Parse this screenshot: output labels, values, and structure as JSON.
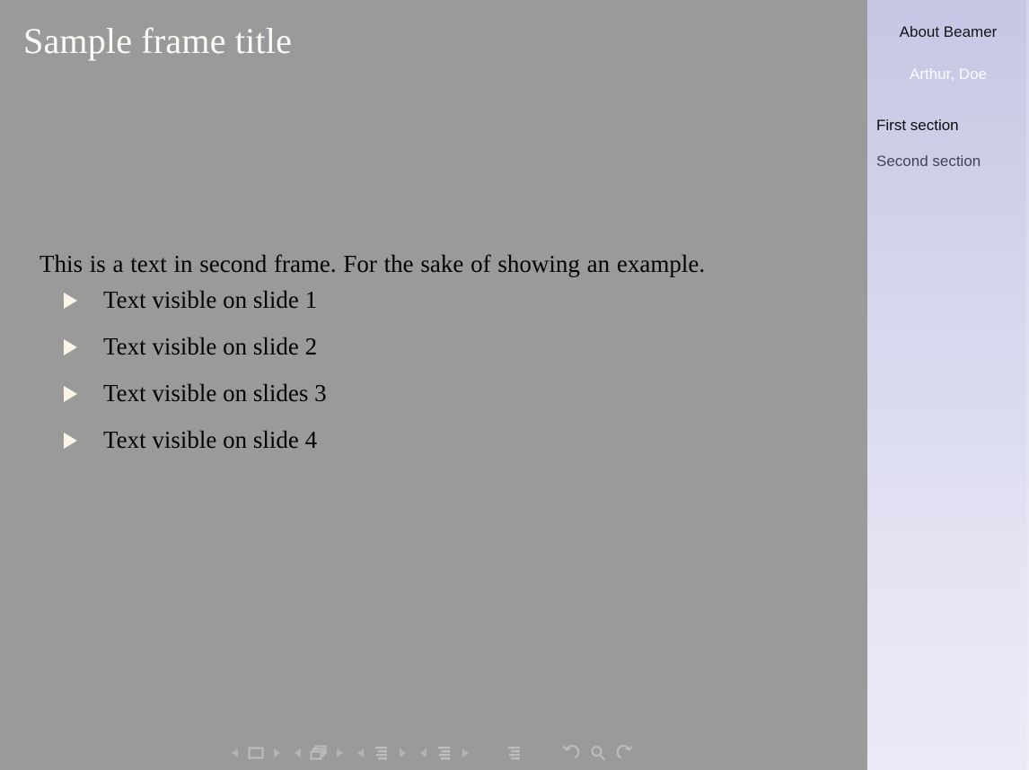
{
  "slide": {
    "frame_title": "Sample frame title",
    "body_paragraph": "This is a text in second frame. For the sake of showing an example.",
    "items": [
      {
        "label": "Text visible on slide 1"
      },
      {
        "label": "Text visible on slide 2"
      },
      {
        "label": "Text visible on slides 3"
      },
      {
        "label": "Text visible on slide 4"
      }
    ]
  },
  "sidebar": {
    "presentation_title": "About Beamer",
    "author": "Arthur, Doe",
    "sections": [
      {
        "label": "First section",
        "state": "active"
      },
      {
        "label": "Second section",
        "state": "inactive"
      }
    ]
  },
  "navbar": {
    "groups": [
      {
        "name": "slide-navigation",
        "prev_icon": "triangle-left-icon",
        "symbol_icon": "single-slide-icon",
        "next_icon": "triangle-right-icon"
      },
      {
        "name": "frame-navigation",
        "prev_icon": "triangle-left-icon",
        "symbol_icon": "stacked-frames-icon",
        "next_icon": "triangle-right-icon"
      },
      {
        "name": "subsection-navigation",
        "prev_icon": "triangle-left-icon",
        "symbol_icon": "subsection-lines-icon",
        "next_icon": "triangle-right-icon"
      },
      {
        "name": "section-navigation",
        "prev_icon": "triangle-left-icon",
        "symbol_icon": "section-lines-icon",
        "next_icon": "triangle-right-icon"
      }
    ],
    "toc_icon": "table-of-contents-icon",
    "back_icon": "back-arrow-icon",
    "search_icon": "search-magnifier-icon",
    "forward_icon": "forward-arrow-icon"
  },
  "colors": {
    "slide_background": "#9a9a9a",
    "sidebar_top": "#c7c7e6",
    "sidebar_bottom": "#eaeaf7",
    "title_text": "#fdfbf5",
    "body_text": "#000000",
    "bullet": "#fdf6e8",
    "sidebar_active": "#0a0a0a",
    "sidebar_inactive": "#41415f",
    "sidebar_author": "#fbfbff",
    "nav_symbol": "#b9b9b9"
  }
}
